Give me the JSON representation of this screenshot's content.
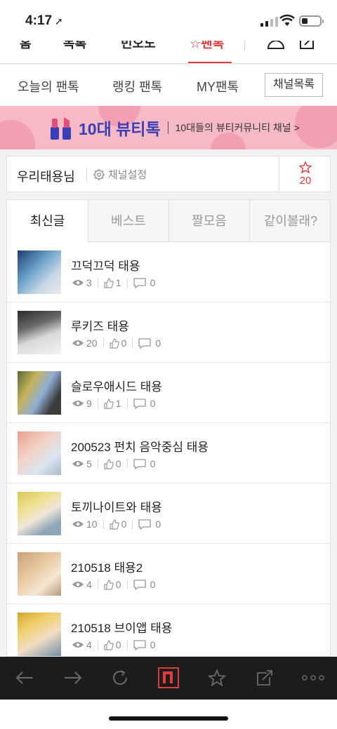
{
  "status": {
    "time": "4:17"
  },
  "topnav": {
    "items": [
      "홈",
      "목록",
      "빈오노",
      "팬톡"
    ]
  },
  "subnav": {
    "tabs": [
      "오늘의 팬톡",
      "랭킹 팬톡",
      "MY팬톡"
    ],
    "channel_list_button": "채널목록"
  },
  "banner": {
    "title": "10대 뷰티톡",
    "description": "10대들의 뷰티커뮤니티 채널 >"
  },
  "channel": {
    "name": "우리태용님",
    "settings_label": "채널설정",
    "favorite_count": "20"
  },
  "content_tabs": [
    "최신글",
    "베스트",
    "짤모음",
    "같이볼래?"
  ],
  "posts": [
    {
      "title": "끄덕끄덕 태용",
      "views": "3",
      "likes": "1",
      "comments": "0"
    },
    {
      "title": "루키즈 태용",
      "views": "20",
      "likes": "0",
      "comments": "0"
    },
    {
      "title": "슬로우애시드 태용",
      "views": "9",
      "likes": "1",
      "comments": "0"
    },
    {
      "title": "200523 펀치 음악중심 태용",
      "views": "5",
      "likes": "0",
      "comments": "0"
    },
    {
      "title": "토끼나이트와 태용",
      "views": "10",
      "likes": "0",
      "comments": "0"
    },
    {
      "title": "210518 태용2",
      "views": "4",
      "likes": "0",
      "comments": "0"
    },
    {
      "title": "210518 브이앱 태용",
      "views": "4",
      "likes": "0",
      "comments": "0"
    }
  ],
  "colors": {
    "accent": "#e23b3b",
    "banner_bg": "#f6b9c6",
    "banner_title": "#3b3fb7",
    "toolbar_bg": "#1c1c1c"
  },
  "icons": [
    "back-arrow-icon",
    "forward-arrow-icon",
    "refresh-icon",
    "n-home-icon",
    "star-icon",
    "share-icon",
    "more-icon"
  ]
}
